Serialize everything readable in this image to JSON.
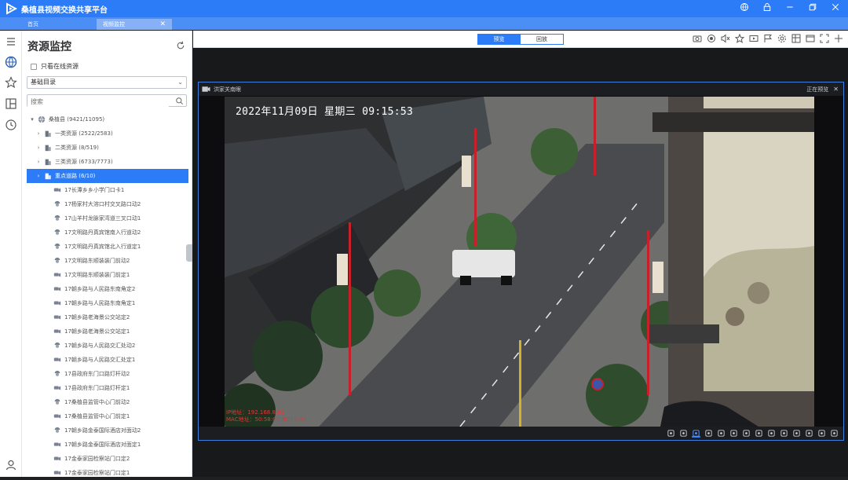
{
  "app": {
    "title": "桑植县视频交换共享平台"
  },
  "tabs": [
    {
      "label": "首页"
    },
    {
      "label": "视频监控",
      "close": "✕"
    }
  ],
  "sidebar": {
    "title": "资源监控",
    "online_only_label": "只看在线资源",
    "directory_select": "基础目录",
    "search_placeholder": "搜索",
    "tree": [
      {
        "caret": "▾",
        "label": "桑植县 (9421/11095)",
        "icon": "globe"
      },
      {
        "caret": "›",
        "label": "一类资源 (2522/2583)",
        "icon": "building"
      },
      {
        "caret": "›",
        "label": "二类资源 (8/519)",
        "icon": "building"
      },
      {
        "caret": "›",
        "label": "三类资源 (6733/7773)",
        "icon": "building"
      },
      {
        "caret": "›",
        "label": "重点道路 (6/10)",
        "icon": "building",
        "selected": true
      },
      {
        "caret": "",
        "label": "17长潭乡乡小学门口卡1",
        "icon": "camera"
      },
      {
        "caret": "",
        "label": "17杨家村大溶口村交叉路口动2",
        "icon": "dome"
      },
      {
        "caret": "",
        "label": "17山羊村龙脉家湾道三叉口动1",
        "icon": "dome"
      },
      {
        "caret": "",
        "label": "17文明路丹真宾馆南入行道动2",
        "icon": "dome"
      },
      {
        "caret": "",
        "label": "17文明路丹真宾馆北入行道定1",
        "icon": "dome"
      },
      {
        "caret": "",
        "label": "17文明路东顺装装门前动2",
        "icon": "dome"
      },
      {
        "caret": "",
        "label": "17文明路东顺装装门前定1",
        "icon": "camera"
      },
      {
        "caret": "",
        "label": "17朝乡路与人民路东南角定2",
        "icon": "camera"
      },
      {
        "caret": "",
        "label": "17朝乡路与人民路东南角定1",
        "icon": "camera"
      },
      {
        "caret": "",
        "label": "17朝乡路老海景公交站定2",
        "icon": "camera"
      },
      {
        "caret": "",
        "label": "17朝乡路老海景公交站定1",
        "icon": "camera"
      },
      {
        "caret": "",
        "label": "17朝乡路与人民路交汇处动2",
        "icon": "dome"
      },
      {
        "caret": "",
        "label": "17朝乡路与人民路交汇处定1",
        "icon": "camera"
      },
      {
        "caret": "",
        "label": "17县政府东门口路灯杆动2",
        "icon": "dome"
      },
      {
        "caret": "",
        "label": "17县政府东门口路灯杆定1",
        "icon": "camera"
      },
      {
        "caret": "",
        "label": "17桑植县监管中心门前动2",
        "icon": "dome"
      },
      {
        "caret": "",
        "label": "17桑植县监管中心门前定1",
        "icon": "camera"
      },
      {
        "caret": "",
        "label": "17朝乡路金泰国际酒店对面动2",
        "icon": "dome"
      },
      {
        "caret": "",
        "label": "17朝乡路金泰国际酒店对面定1",
        "icon": "camera"
      },
      {
        "caret": "",
        "label": "17金泰家园检察站门口定2",
        "icon": "camera"
      },
      {
        "caret": "",
        "label": "17金泰家园检察站门口定1",
        "icon": "camera"
      }
    ]
  },
  "toolbar": {
    "preview_label": "预览",
    "playback_label": "回放",
    "icons": [
      "camera-icon",
      "record-icon",
      "mute-icon",
      "star-icon",
      "video-icon",
      "flag-icon",
      "settings-icon",
      "layout-icon",
      "window-icon",
      "fullscreen-icon",
      "more-icon"
    ]
  },
  "player": {
    "camera_name": "洪家关南眼",
    "status": "正在预览",
    "close": "✕",
    "osd_time": "2022年11月09日  星期三  09:15:53",
    "osd_ip": "IP地址：192.168.8.61",
    "osd_mac": "MAC地址：50:58:C2:9C:F8:20",
    "control_icons": [
      "snapshot-icon",
      "record-icon",
      "person-icon",
      "rotate-icon",
      "mic-icon",
      "zoom-icon",
      "ptz-icon",
      "ratio-icon",
      "grid-icon",
      "export-icon",
      "stream-icon",
      "volume-icon",
      "alarm-icon",
      "gesture-icon"
    ]
  },
  "colors": {
    "brand": "#2b7cf6",
    "selected_row": "#2b7cf6",
    "osd_info": "#e53535"
  }
}
